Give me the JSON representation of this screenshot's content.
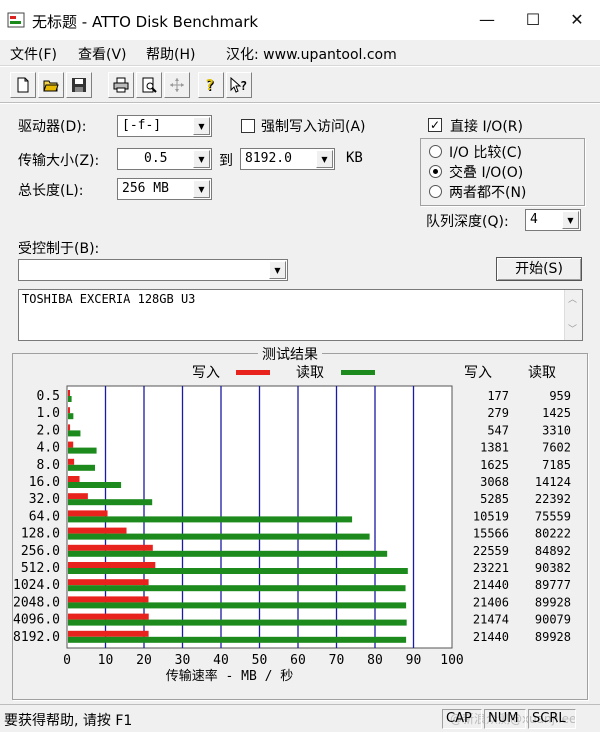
{
  "window": {
    "title": "无标题 - ATTO Disk Benchmark",
    "minimize_glyph": "—",
    "maximize_glyph": "☐",
    "close_glyph": "✕"
  },
  "menu": {
    "file": "文件(F)",
    "view": "查看(V)",
    "help": "帮助(H)",
    "hanhua": "汉化: www.upantool.com"
  },
  "toolbar": {
    "icons": [
      "new-icon",
      "open-icon",
      "save-icon",
      "print-icon",
      "print-preview-icon",
      "move-icon",
      "help-icon",
      "context-help-icon"
    ]
  },
  "form": {
    "drive_label": "驱动器(D):",
    "drive_value": "[-f-]",
    "force_write_label": "强制写入访问(A)",
    "direct_io_label": "直接 I/O(R)",
    "direct_io_checked": "✓",
    "transfer_size_label": "传输大小(Z):",
    "transfer_from": "0.5",
    "to_label": "到",
    "transfer_to": "8192.0",
    "kb_label": "KB",
    "total_length_label": "总长度(L):",
    "total_length": "256 MB",
    "io_compare_label": "I/O 比较(C)",
    "overlapped_io_label": "交叠 I/O(O)",
    "neither_label": "两者都不(N)",
    "queue_depth_label": "队列深度(Q):",
    "queue_depth": "4",
    "controlled_by_label": "受控制于(B):",
    "controlled_by_value": "",
    "start_button": "开始(S)",
    "description": "TOSHIBA EXCERIA 128GB U3"
  },
  "results": {
    "group_title": "测试结果",
    "legend_write": "写入",
    "legend_read": "读取",
    "col_write": "写入",
    "col_read": "读取",
    "write_color": "#e8231e",
    "read_color": "#1c8a1c",
    "grid_color": "#1a1aa6"
  },
  "chart_data": {
    "type": "bar",
    "orientation": "horizontal",
    "categories": [
      "0.5",
      "1.0",
      "2.0",
      "4.0",
      "8.0",
      "16.0",
      "32.0",
      "64.0",
      "128.0",
      "256.0",
      "512.0",
      "1024.0",
      "2048.0",
      "4096.0",
      "8192.0"
    ],
    "series": [
      {
        "name": "写入",
        "values": [
          177,
          279,
          547,
          1381,
          1625,
          3068,
          5285,
          10519,
          15566,
          22559,
          23221,
          21440,
          21406,
          21474,
          21440
        ]
      },
      {
        "name": "读取",
        "values": [
          959,
          1425,
          3310,
          7602,
          7185,
          14124,
          22392,
          75559,
          80222,
          84892,
          90382,
          89777,
          89928,
          90079,
          89928
        ]
      }
    ],
    "xlabel": "传输速率 - MB / 秒",
    "xlim": [
      0,
      100
    ],
    "xticks": [
      "0",
      "10",
      "20",
      "30",
      "40",
      "50",
      "60",
      "70",
      "80",
      "90",
      "100"
    ],
    "grid": true,
    "legend_position": "top"
  },
  "status": {
    "help_text": "要获得帮助, 请按 F1",
    "cap": "CAP",
    "num": "NUM",
    "scrl": "SCRL",
    "watermark": "@新浪众测@xuanjilee"
  }
}
